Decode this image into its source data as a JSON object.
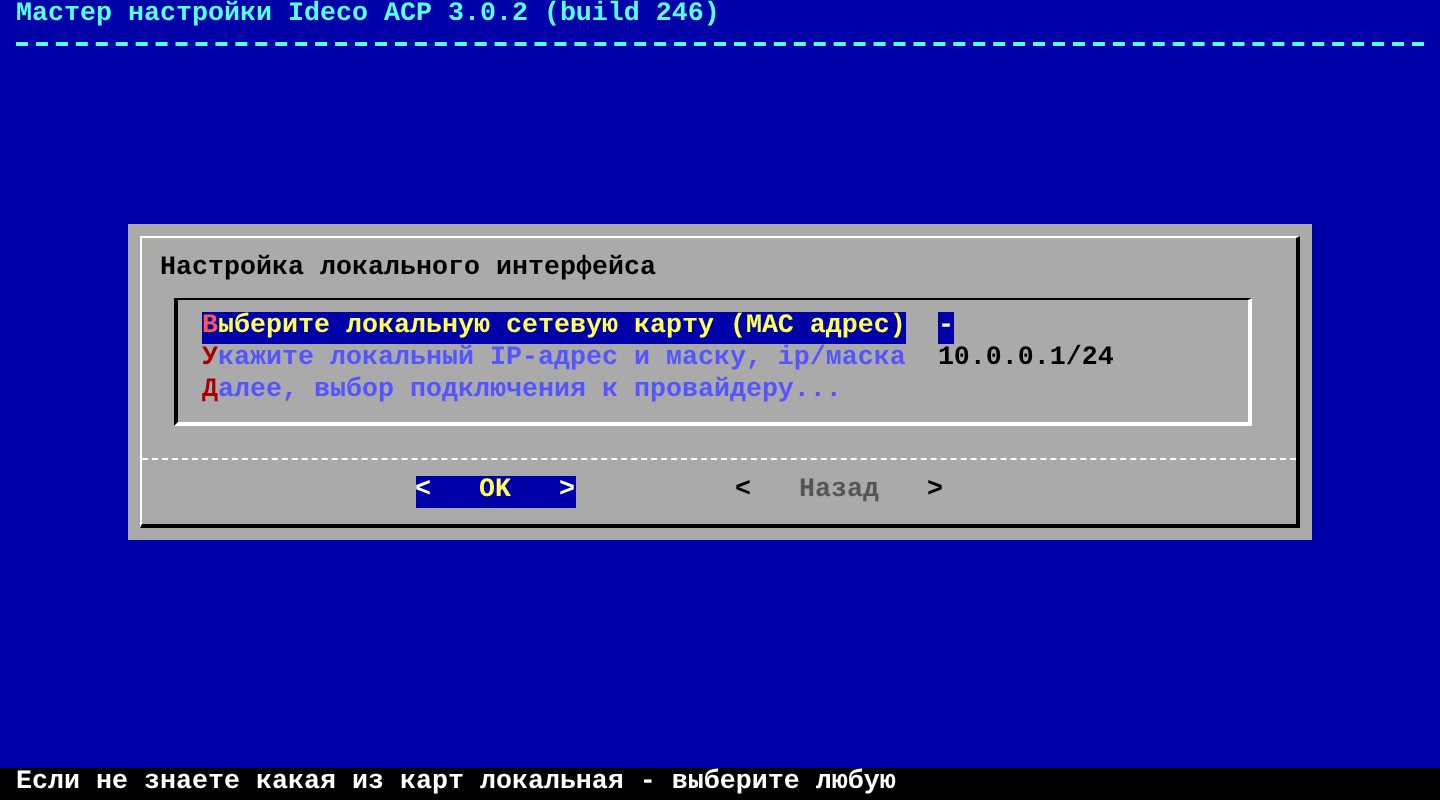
{
  "window": {
    "title": "Мастер настройки Ideco ACP 3.0.2 (build 246)"
  },
  "dialog": {
    "title": "Настройка локального интерфейса",
    "menu": [
      {
        "label": "Выберите локальную сетевую карту (MAC адрес)",
        "value": "-",
        "selected": true
      },
      {
        "label": "Укажите локальный IP-адрес и маску, ip/маска",
        "value": "10.0.0.1/24",
        "selected": false
      },
      {
        "label": "Далее, выбор подключения к провайдеру...",
        "selected": false
      }
    ],
    "buttons": [
      {
        "open": "<",
        "label": "OK",
        "close": ">",
        "selected": true
      },
      {
        "open": "<",
        "label": "Назад",
        "close": ">",
        "selected": false
      }
    ]
  },
  "status_bar": "Если не знаете какая из карт локальная - выберите любую"
}
